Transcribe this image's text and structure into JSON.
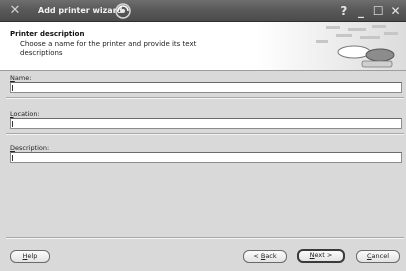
{
  "window": {
    "title": "Add printer wizard",
    "controls": {
      "help": "?",
      "minimize": "_",
      "maximize": "☐",
      "close": "✕"
    }
  },
  "header": {
    "title": "Printer description",
    "subtitle": "Choose a name for the printer and provide its text descriptions"
  },
  "fields": {
    "name": {
      "label_key": "N",
      "label_rest": "ame:",
      "value": ""
    },
    "location": {
      "label_key": "L",
      "label_rest": "ocation:",
      "value": ""
    },
    "description": {
      "label_key": "D",
      "label_rest": "escription:",
      "value": ""
    }
  },
  "buttons": {
    "help": {
      "key": "H",
      "rest": "elp"
    },
    "back": {
      "prefix": "< ",
      "key": "B",
      "rest": "ack"
    },
    "next": {
      "key": "N",
      "rest": "ext >"
    },
    "cancel": {
      "key": "C",
      "rest": "ancel"
    }
  }
}
